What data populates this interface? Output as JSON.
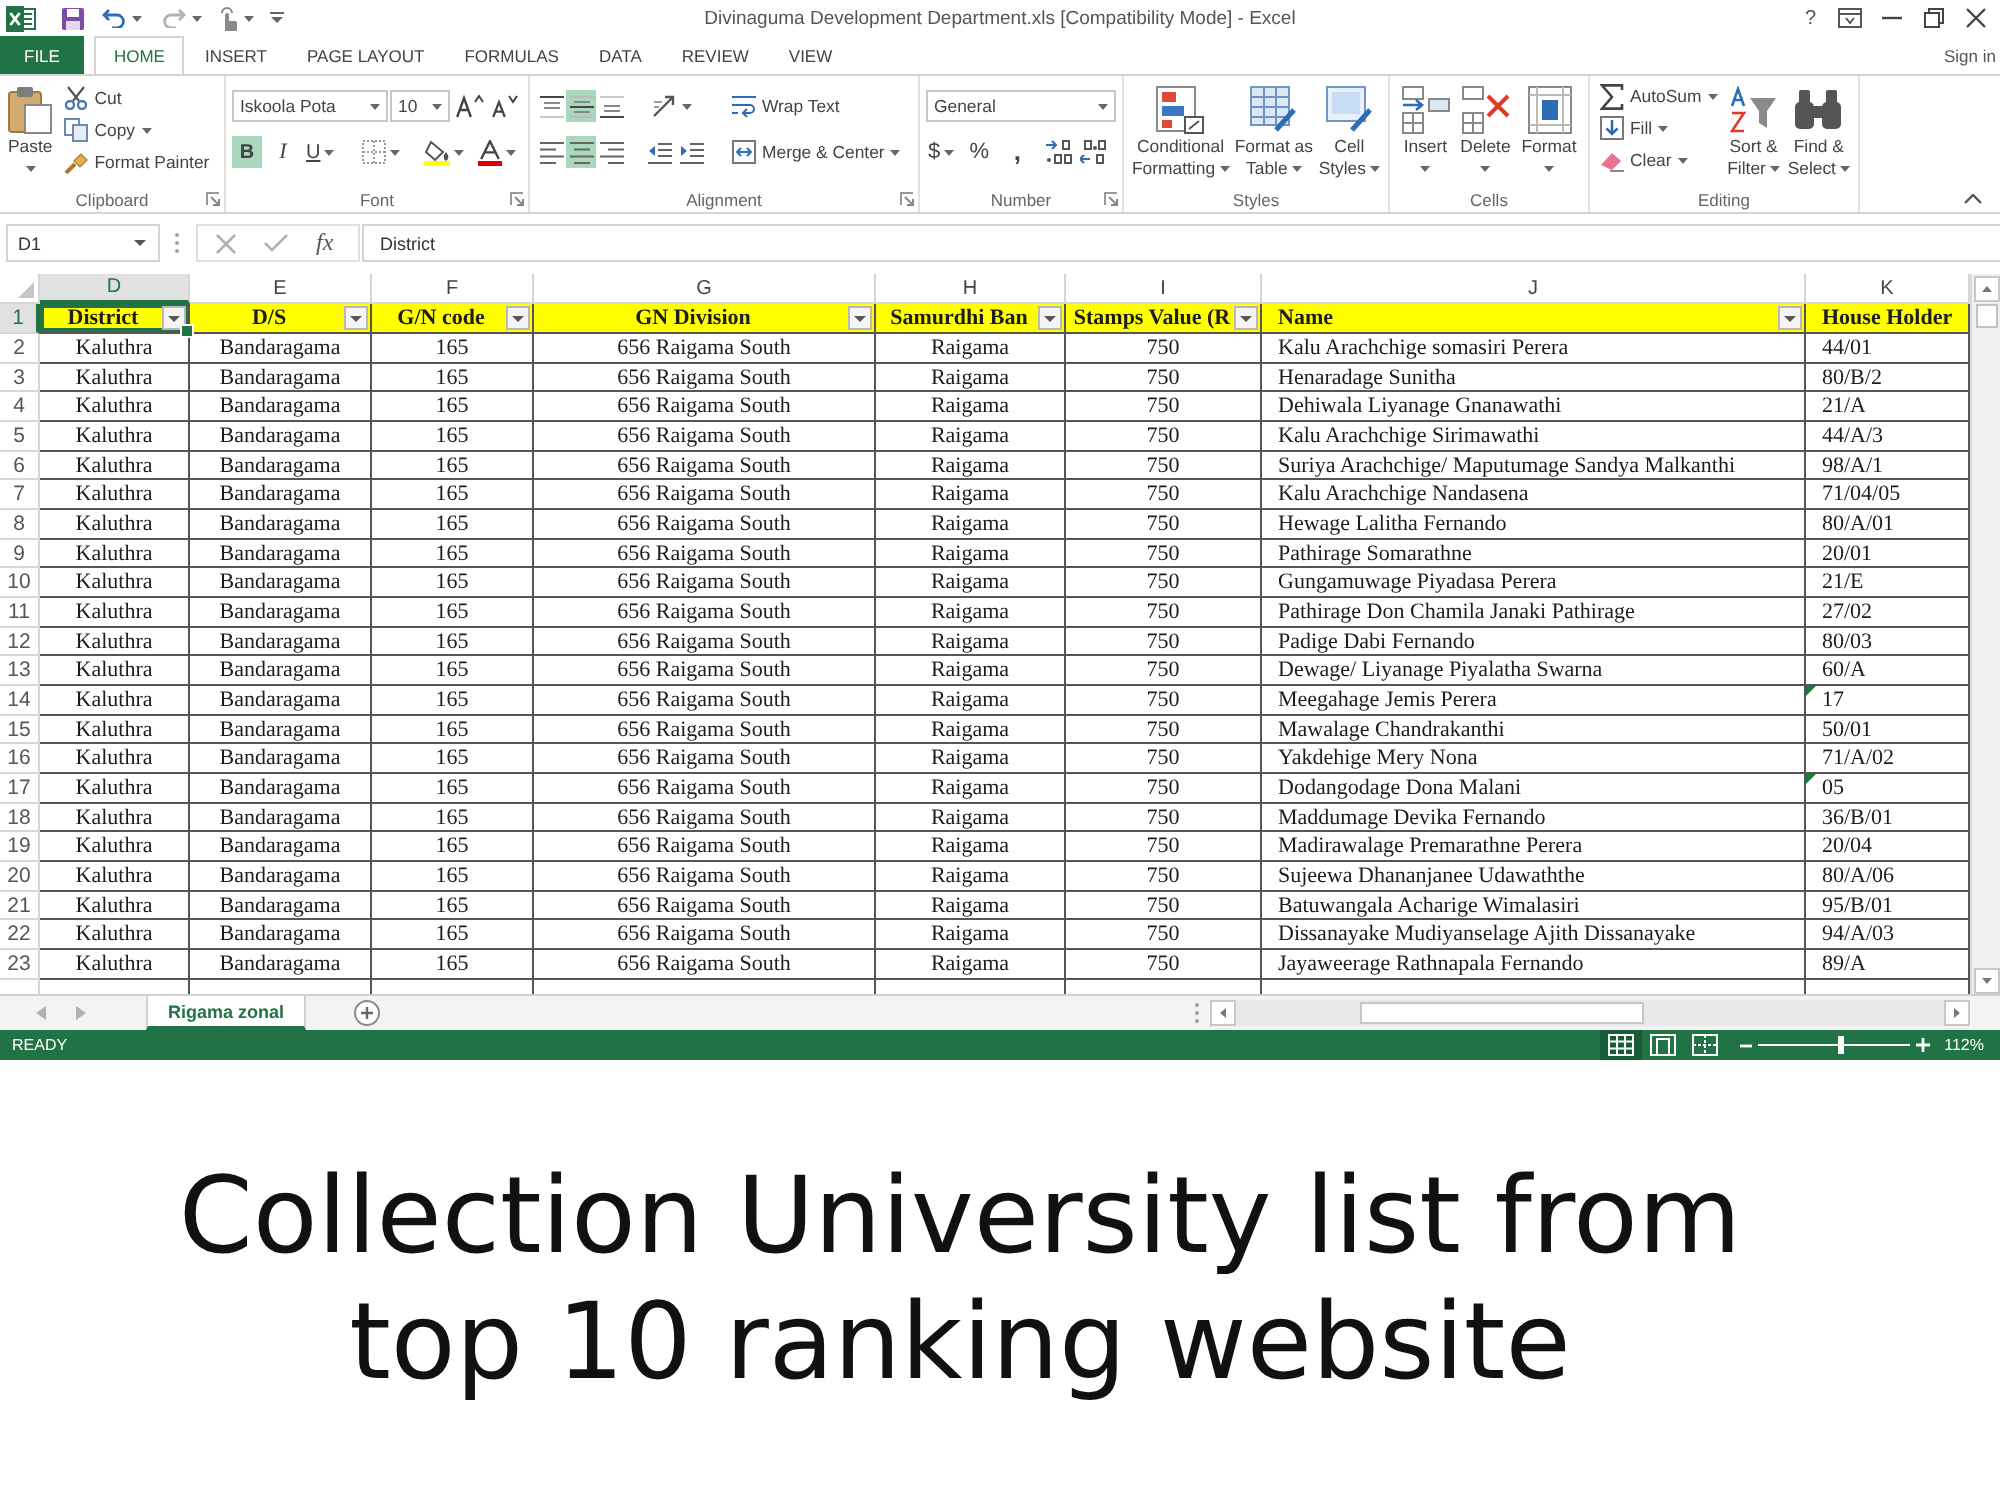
{
  "window": {
    "title": "Divinaguma Development Department.xls [Compatibility Mode] - Excel",
    "help": "?",
    "sign_in": "Sign in"
  },
  "quick_access": [
    {
      "disabled": false,
      "menu": false
    },
    {
      "disabled": false,
      "menu": true
    },
    {
      "disabled": true,
      "menu": true
    },
    {
      "disabled": false,
      "menu": true
    },
    {
      "disabled": false,
      "menu": false
    }
  ],
  "tabs": [
    {
      "label": "FILE",
      "kind": "file",
      "selected": false
    },
    {
      "label": "HOME",
      "kind": "tab",
      "selected": true
    },
    {
      "label": "INSERT",
      "kind": "tab",
      "selected": false
    },
    {
      "label": "PAGE LAYOUT",
      "kind": "tab",
      "selected": false
    },
    {
      "label": "FORMULAS",
      "kind": "tab",
      "selected": false
    },
    {
      "label": "DATA",
      "kind": "tab",
      "selected": false
    },
    {
      "label": "REVIEW",
      "kind": "tab",
      "selected": false
    },
    {
      "label": "VIEW",
      "kind": "tab",
      "selected": false
    }
  ],
  "ribbon": {
    "groups": [
      {
        "label": "Clipboard",
        "launcher": true,
        "kind": "stacks",
        "stacks": [
          [
            {
              "kind": "large",
              "label": "Paste",
              "menu": true
            }
          ],
          [
            {
              "kind": "small",
              "label": "Cut",
              "menu": false
            },
            {
              "kind": "small",
              "label": "Copy",
              "menu": true
            },
            {
              "kind": "small",
              "label": "Format Painter",
              "menu": false
            }
          ]
        ]
      },
      {
        "label": "Font",
        "launcher": true,
        "kind": "lines",
        "lines": [
          [
            {
              "kind": "field",
              "value": "Iskoola Pota"
            },
            {
              "kind": "field",
              "value": "10"
            },
            {
              "kind": "icon",
              "active": false,
              "menu": false
            },
            {
              "kind": "icon",
              "active": false,
              "menu": false
            }
          ],
          [
            {
              "kind": "text",
              "label": "B",
              "active": true,
              "menu": false
            },
            {
              "kind": "text",
              "label": "I",
              "active": false,
              "menu": false
            },
            {
              "kind": "text",
              "label": "U",
              "active": false,
              "menu": true
            },
            {
              "kind": "icon",
              "active": false,
              "menu": true
            },
            {
              "kind": "icon",
              "active": false,
              "menu": true
            },
            {
              "kind": "icon",
              "active": false,
              "menu": true
            }
          ]
        ]
      },
      {
        "label": "Alignment",
        "launcher": true,
        "kind": "lines",
        "lines": [
          [
            {
              "kind": "icon",
              "active": false,
              "menu": false
            },
            {
              "kind": "icon",
              "active": true,
              "menu": false
            },
            {
              "kind": "icon",
              "active": false,
              "menu": false
            },
            {
              "kind": "icon",
              "active": false,
              "menu": true
            },
            {
              "kind": "small",
              "label": "Wrap Text",
              "menu": false
            }
          ],
          [
            {
              "kind": "icon",
              "active": false,
              "menu": false
            },
            {
              "kind": "icon",
              "active": true,
              "menu": false
            },
            {
              "kind": "icon",
              "active": false,
              "menu": false
            },
            {
              "kind": "icon",
              "active": false,
              "menu": false
            },
            {
              "kind": "icon",
              "active": false,
              "menu": false
            },
            {
              "kind": "small",
              "label": "Merge & Center",
              "menu": true
            }
          ]
        ]
      },
      {
        "label": "Number",
        "launcher": true,
        "kind": "lines",
        "lines": [
          [
            {
              "kind": "field",
              "value": "General"
            }
          ],
          [
            {
              "kind": "text",
              "label": "$",
              "active": false,
              "menu": true
            },
            {
              "kind": "text",
              "label": "%",
              "active": false,
              "menu": false
            },
            {
              "kind": "text",
              "label": ",",
              "active": false,
              "menu": false
            },
            {
              "kind": "icon",
              "active": false,
              "menu": false
            },
            {
              "kind": "icon",
              "active": false,
              "menu": false
            }
          ]
        ]
      },
      {
        "label": "Styles",
        "launcher": false,
        "kind": "stacks",
        "stacks": [
          [
            {
              "kind": "large",
              "label": "Conditional Formatting",
              "menu": true
            }
          ],
          [
            {
              "kind": "large",
              "label": "Format as Table",
              "menu": true
            }
          ],
          [
            {
              "kind": "large",
              "label": "Cell Styles",
              "menu": true
            }
          ]
        ]
      },
      {
        "label": "Cells",
        "launcher": false,
        "kind": "stacks",
        "stacks": [
          [
            {
              "kind": "large",
              "label": "Insert",
              "menu": true
            }
          ],
          [
            {
              "kind": "large",
              "label": "Delete",
              "menu": true
            }
          ],
          [
            {
              "kind": "large",
              "label": "Format",
              "menu": true
            }
          ]
        ]
      },
      {
        "label": "Editing",
        "launcher": false,
        "kind": "stacks",
        "stacks": [
          [
            {
              "kind": "small",
              "label": "AutoSum",
              "menu": true
            },
            {
              "kind": "small",
              "label": "Fill",
              "menu": true
            },
            {
              "kind": "small",
              "label": "Clear",
              "menu": true
            }
          ],
          [
            {
              "kind": "large",
              "label": "Sort & Filter",
              "menu": true
            }
          ],
          [
            {
              "kind": "large",
              "label": "Find & Select",
              "menu": true
            }
          ]
        ]
      }
    ]
  },
  "formula_bar": {
    "name_box": "D1",
    "function_label": "fx",
    "value": "District"
  },
  "sheet": {
    "columns": [
      {
        "letter": "D",
        "selected": true
      },
      {
        "letter": "E",
        "selected": false
      },
      {
        "letter": "F",
        "selected": false
      },
      {
        "letter": "G",
        "selected": false
      },
      {
        "letter": "H",
        "selected": false
      },
      {
        "letter": "I",
        "selected": false
      },
      {
        "letter": "J",
        "selected": false
      },
      {
        "letter": "K",
        "selected": false
      }
    ],
    "header_row": {
      "number": "1",
      "selected": true,
      "cells": [
        {
          "text": "District",
          "filter": true
        },
        {
          "text": "D/S",
          "filter": true
        },
        {
          "text": "G/N code",
          "filter": true
        },
        {
          "text": "GN Division",
          "filter": true
        },
        {
          "text": "Samurdhi Ban",
          "filter": true
        },
        {
          "text": "Stamps Value (R",
          "filter": true
        },
        {
          "text": "Name",
          "filter": true
        },
        {
          "text": "House Holder",
          "filter": false
        }
      ]
    },
    "rows": [
      {
        "number": "2",
        "selected": false,
        "flagged": false,
        "cells": [
          "Kaluthra",
          "Bandaragama",
          "165",
          "656 Raigama South",
          "Raigama",
          "750",
          "Kalu Arachchige somasiri Perera",
          "44/01"
        ]
      },
      {
        "number": "3",
        "selected": false,
        "flagged": false,
        "cells": [
          "Kaluthra",
          "Bandaragama",
          "165",
          "656 Raigama South",
          "Raigama",
          "750",
          "Henaradage Sunitha",
          "80/B/2"
        ]
      },
      {
        "number": "4",
        "selected": false,
        "flagged": false,
        "cells": [
          "Kaluthra",
          "Bandaragama",
          "165",
          "656 Raigama South",
          "Raigama",
          "750",
          "Dehiwala Liyanage Gnanawathi",
          "21/A"
        ]
      },
      {
        "number": "5",
        "selected": false,
        "flagged": false,
        "cells": [
          "Kaluthra",
          "Bandaragama",
          "165",
          "656 Raigama South",
          "Raigama",
          "750",
          "Kalu Arachchige Sirimawathi",
          "44/A/3"
        ]
      },
      {
        "number": "6",
        "selected": false,
        "flagged": false,
        "cells": [
          "Kaluthra",
          "Bandaragama",
          "165",
          "656 Raigama South",
          "Raigama",
          "750",
          "Suriya Arachchige/ Maputumage Sandya Malkanthi",
          "98/A/1"
        ]
      },
      {
        "number": "7",
        "selected": false,
        "flagged": false,
        "cells": [
          "Kaluthra",
          "Bandaragama",
          "165",
          "656 Raigama South",
          "Raigama",
          "750",
          "Kalu Arachchige Nandasena",
          "71/04/05"
        ]
      },
      {
        "number": "8",
        "selected": false,
        "flagged": false,
        "cells": [
          "Kaluthra",
          "Bandaragama",
          "165",
          "656 Raigama South",
          "Raigama",
          "750",
          "Hewage Lalitha Fernando",
          "80/A/01"
        ]
      },
      {
        "number": "9",
        "selected": false,
        "flagged": false,
        "cells": [
          "Kaluthra",
          "Bandaragama",
          "165",
          "656 Raigama South",
          "Raigama",
          "750",
          "Pathirage Somarathne",
          "20/01"
        ]
      },
      {
        "number": "10",
        "selected": false,
        "flagged": false,
        "cells": [
          "Kaluthra",
          "Bandaragama",
          "165",
          "656 Raigama South",
          "Raigama",
          "750",
          "Gungamuwage Piyadasa Perera",
          "21/E"
        ]
      },
      {
        "number": "11",
        "selected": false,
        "flagged": false,
        "cells": [
          "Kaluthra",
          "Bandaragama",
          "165",
          "656 Raigama South",
          "Raigama",
          "750",
          "Pathirage Don Chamila Janaki Pathirage",
          "27/02"
        ]
      },
      {
        "number": "12",
        "selected": false,
        "flagged": false,
        "cells": [
          "Kaluthra",
          "Bandaragama",
          "165",
          "656 Raigama South",
          "Raigama",
          "750",
          "Padige Dabi Fernando",
          "80/03"
        ]
      },
      {
        "number": "13",
        "selected": false,
        "flagged": false,
        "cells": [
          "Kaluthra",
          "Bandaragama",
          "165",
          "656 Raigama South",
          "Raigama",
          "750",
          "Dewage/ Liyanage Piyalatha Swarna",
          "60/A"
        ]
      },
      {
        "number": "14",
        "selected": false,
        "flagged": true,
        "cells": [
          "Kaluthra",
          "Bandaragama",
          "165",
          "656 Raigama South",
          "Raigama",
          "750",
          "Meegahage Jemis Perera",
          "17"
        ]
      },
      {
        "number": "15",
        "selected": false,
        "flagged": false,
        "cells": [
          "Kaluthra",
          "Bandaragama",
          "165",
          "656 Raigama South",
          "Raigama",
          "750",
          "Mawalage Chandrakanthi",
          "50/01"
        ]
      },
      {
        "number": "16",
        "selected": false,
        "flagged": false,
        "cells": [
          "Kaluthra",
          "Bandaragama",
          "165",
          "656 Raigama South",
          "Raigama",
          "750",
          "Yakdehige Mery Nona",
          "71/A/02"
        ]
      },
      {
        "number": "17",
        "selected": false,
        "flagged": true,
        "cells": [
          "Kaluthra",
          "Bandaragama",
          "165",
          "656 Raigama South",
          "Raigama",
          "750",
          "Dodangodage Dona Malani",
          "05"
        ]
      },
      {
        "number": "18",
        "selected": false,
        "flagged": false,
        "cells": [
          "Kaluthra",
          "Bandaragama",
          "165",
          "656 Raigama South",
          "Raigama",
          "750",
          "Maddumage Devika Fernando",
          "36/B/01"
        ]
      },
      {
        "number": "19",
        "selected": false,
        "flagged": false,
        "cells": [
          "Kaluthra",
          "Bandaragama",
          "165",
          "656 Raigama South",
          "Raigama",
          "750",
          "Madirawalage Premarathne Perera",
          "20/04"
        ]
      },
      {
        "number": "20",
        "selected": false,
        "flagged": false,
        "cells": [
          "Kaluthra",
          "Bandaragama",
          "165",
          "656 Raigama South",
          "Raigama",
          "750",
          "Sujeewa Dhananjanee Udawaththe",
          "80/A/06"
        ]
      },
      {
        "number": "21",
        "selected": false,
        "flagged": false,
        "cells": [
          "Kaluthra",
          "Bandaragama",
          "165",
          "656 Raigama South",
          "Raigama",
          "750",
          "Batuwangala Acharige Wimalasiri",
          "95/B/01"
        ]
      },
      {
        "number": "22",
        "selected": false,
        "flagged": false,
        "cells": [
          "Kaluthra",
          "Bandaragama",
          "165",
          "656 Raigama South",
          "Raigama",
          "750",
          "Dissanayake Mudiyanselage Ajith Dissanayake",
          "94/A/03"
        ]
      },
      {
        "number": "23",
        "selected": false,
        "flagged": false,
        "cells": [
          "Kaluthra",
          "Bandaragama",
          "165",
          "656 Raigama South",
          "Raigama",
          "750",
          "Jayaweerage Rathnapala Fernando",
          "89/A"
        ]
      }
    ]
  },
  "sheet_tabs": [
    {
      "label": "Rigama zonal",
      "selected": true
    }
  ],
  "status_bar": {
    "status": "READY",
    "views": [
      {
        "selected": true
      },
      {
        "selected": false
      },
      {
        "selected": false
      }
    ],
    "zoom": {
      "level": 0.54,
      "reading": "112%"
    }
  },
  "caption": "Collection University list from top 10 ranking website"
}
